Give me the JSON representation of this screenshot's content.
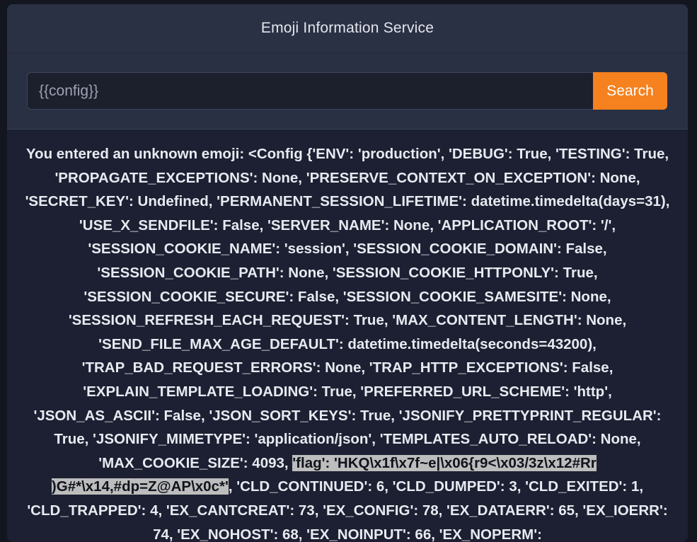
{
  "header": {
    "title": "Emoji Information Service"
  },
  "search": {
    "value": "{{config}}",
    "button_label": "Search"
  },
  "result": {
    "text_before": "You entered an unknown emoji: <Config {'ENV': 'production', 'DEBUG': True, 'TESTING': True, 'PROPAGATE_EXCEPTIONS': None, 'PRESERVE_CONTEXT_ON_EXCEPTION': None, 'SECRET_KEY': Undefined, 'PERMANENT_SESSION_LIFETIME': datetime.timedelta(days=31), 'USE_X_SENDFILE': False, 'SERVER_NAME': None, 'APPLICATION_ROOT': '/', 'SESSION_COOKIE_NAME': 'session', 'SESSION_COOKIE_DOMAIN': False, 'SESSION_COOKIE_PATH': None, 'SESSION_COOKIE_HTTPONLY': True, 'SESSION_COOKIE_SECURE': False, 'SESSION_COOKIE_SAMESITE': None, 'SESSION_REFRESH_EACH_REQUEST': True, 'MAX_CONTENT_LENGTH': None, 'SEND_FILE_MAX_AGE_DEFAULT': datetime.timedelta(seconds=43200), 'TRAP_BAD_REQUEST_ERRORS': None, 'TRAP_HTTP_EXCEPTIONS': False, 'EXPLAIN_TEMPLATE_LOADING': True, 'PREFERRED_URL_SCHEME': 'http', 'JSON_AS_ASCII': False, 'JSON_SORT_KEYS': True, 'JSONIFY_PRETTYPRINT_REGULAR': True, 'JSONIFY_MIMETYPE': 'application/json', 'TEMPLATES_AUTO_RELOAD': None, 'MAX_COOKIE_SIZE': 4093, ",
    "highlighted": "'flag': 'HKQ\\x1f\\x7f~e|\\x06{r9<\\x03/3z\\x12#Rr )G#*\\x14,#dp=Z@AP\\x0c*'",
    "text_after": ", 'CLD_CONTINUED': 6, 'CLD_DUMPED': 3, 'CLD_EXITED': 1, 'CLD_TRAPPED': 4, 'EX_CANTCREAT': 73, 'EX_CONFIG': 78, 'EX_DATAERR': 65, 'EX_IOERR': 74, 'EX_NOHOST': 68, 'EX_NOINPUT': 66, 'EX_NOPERM':"
  }
}
